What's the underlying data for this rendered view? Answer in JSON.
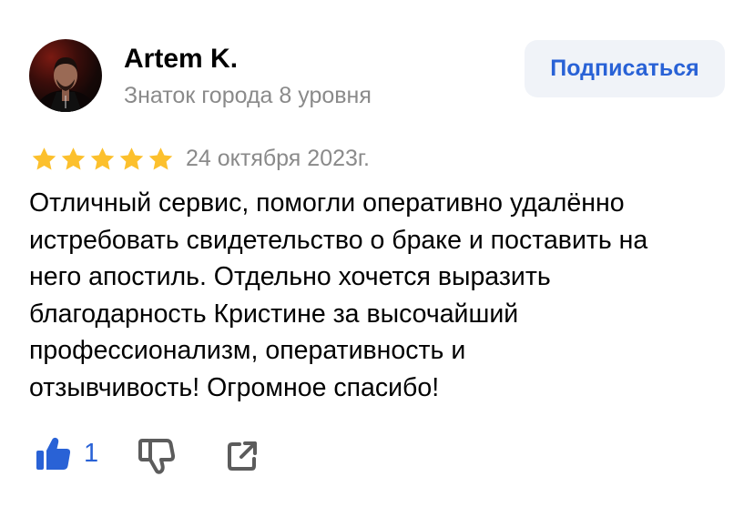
{
  "review": {
    "author": {
      "name": "Artem K.",
      "level": "Знаток города 8 уровня"
    },
    "subscribe_label": "Подписаться",
    "rating": 5,
    "date": "24 октября 2023г.",
    "text": "Отличный сервис, помогли оперативно удалённо\nистребовать свидетельство о браке и поставить на\nнего апостиль. Отдельно хочется выразить\nблагодарность Кристине за высочайший\nпрофессионализм, оперативность и\nотзывчивость! Огромное спасибо!",
    "likes": "1"
  },
  "icons": {
    "avatar": "user-photo",
    "star": "star-icon",
    "like": "thumbs-up-icon",
    "dislike": "thumbs-down-icon",
    "share": "share-icon"
  },
  "colors": {
    "star": "#FCC02D",
    "accent": "#2962D6",
    "secondary_text": "#8A8A8A",
    "button_bg": "#F0F3F8",
    "icon_gray": "#5C5C5C"
  }
}
